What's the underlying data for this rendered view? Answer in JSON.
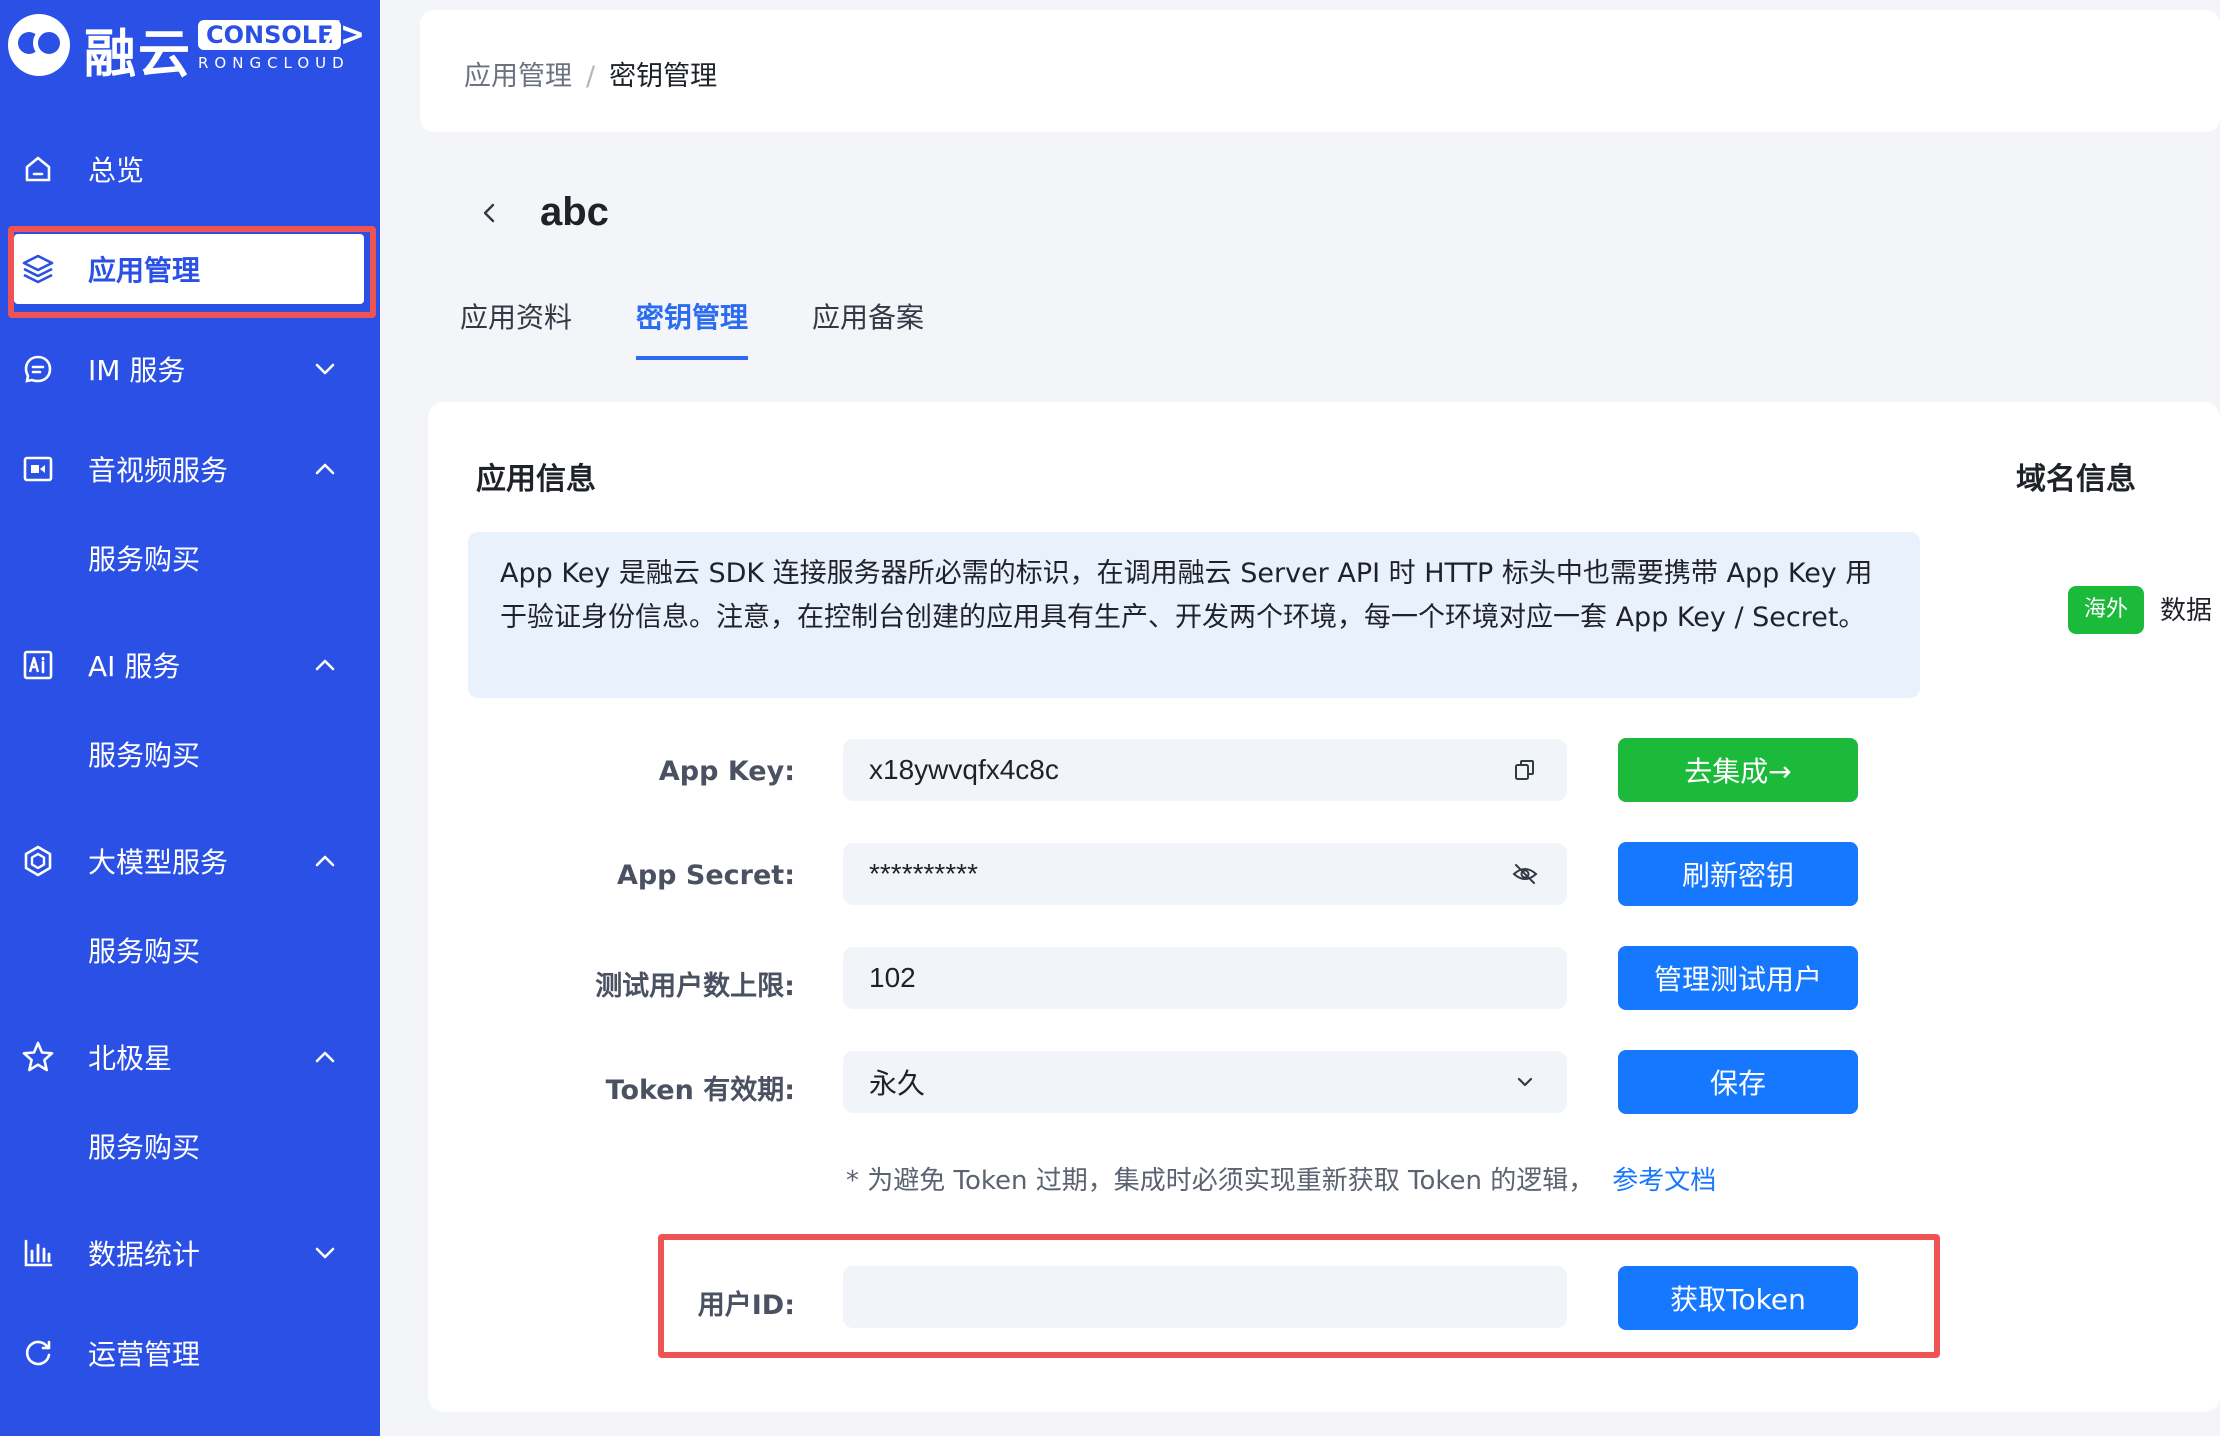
{
  "brand": {
    "name": "融云",
    "console": "CONSOLE",
    "slash": "/>",
    "sub": "RONGCLOUD",
    "color": "#2b50e6"
  },
  "sidebar": {
    "items": [
      {
        "label": "总览",
        "icon": "home-icon"
      },
      {
        "label": "应用管理",
        "icon": "layers-icon",
        "active": true
      },
      {
        "label": "IM 服务",
        "icon": "chat-icon",
        "expanded": false
      },
      {
        "label": "音视频服务",
        "icon": "video-icon",
        "expanded": true,
        "sub": "服务购买"
      },
      {
        "label": "AI 服务",
        "icon": "ai-icon",
        "expanded": true,
        "sub": "服务购买"
      },
      {
        "label": "大模型服务",
        "icon": "model-icon",
        "expanded": true,
        "sub": "服务购买"
      },
      {
        "label": "北极星",
        "icon": "star-icon",
        "expanded": true,
        "sub": "服务购买"
      },
      {
        "label": "数据统计",
        "icon": "bar-chart-icon",
        "expanded": false
      },
      {
        "label": "运营管理",
        "icon": "refresh-icon"
      }
    ]
  },
  "breadcrumb": {
    "parent": "应用管理",
    "separator": "/",
    "current": "密钥管理"
  },
  "page": {
    "title": "abc"
  },
  "tabs": [
    {
      "label": "应用资料",
      "active": false
    },
    {
      "label": "密钥管理",
      "active": true
    },
    {
      "label": "应用备案",
      "active": false
    }
  ],
  "app_info": {
    "section_title": "应用信息",
    "notice": "App Key 是融云 SDK 连接服务器所必需的标识，在调用融云 Server API 时 HTTP 标头中也需要携带 App Key 用于验证身份信息。注意，在控制台创建的应用具有生产、开发两个环境，每一个环境对应一套 App Key / Secret。",
    "fields": {
      "app_key_label": "App Key:",
      "app_key_value": "x18ywvqfx4c8c",
      "app_key_button": "去集成→",
      "app_secret_label": "App Secret:",
      "app_secret_value": "**********",
      "app_secret_button": "刷新密钥",
      "test_users_label": "测试用户数上限:",
      "test_users_value": "102",
      "test_users_button": "管理测试用户",
      "token_label": "Token 有效期:",
      "token_value": "永久",
      "token_button": "保存",
      "hint": "* 为避免 Token 过期，集成时必须实现重新获取 Token 的逻辑，",
      "hint_link": "参考文档",
      "user_id_label": "用户ID:",
      "user_id_value": "",
      "user_id_button": "获取Token"
    }
  },
  "domain_info": {
    "section_title": "域名信息",
    "badge": "海外",
    "text": "数据"
  },
  "colors": {
    "primary": "#1677ff",
    "success": "#1cba3b",
    "highlight": "#ef5454"
  }
}
